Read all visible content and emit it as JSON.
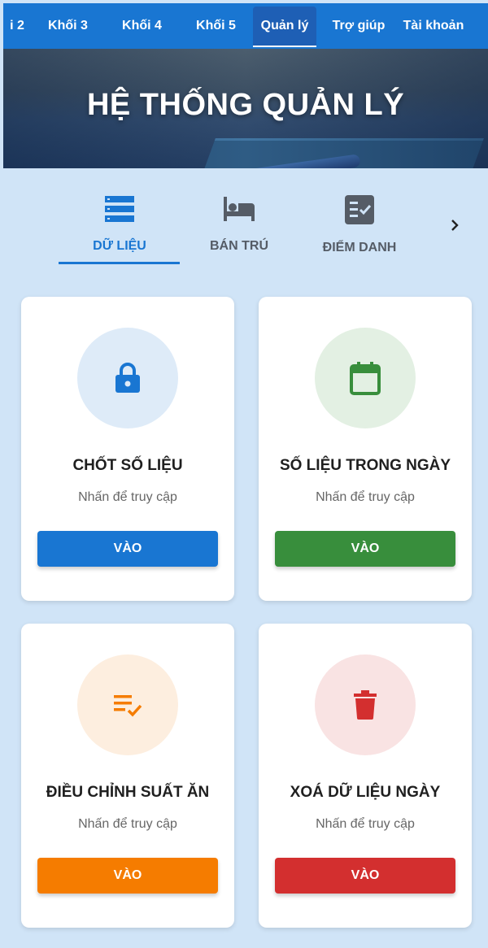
{
  "nav": {
    "items": [
      {
        "label": "i 2"
      },
      {
        "label": "Khối 3"
      },
      {
        "label": "Khối 4"
      },
      {
        "label": "Khối 5"
      },
      {
        "label": "Quản lý",
        "active": true
      },
      {
        "label": "Trợ giúp"
      },
      {
        "label": "Tài khoản"
      }
    ]
  },
  "hero": {
    "title": "HỆ THỐNG QUẢN LÝ"
  },
  "tabs": [
    {
      "label": "DỮ LIỆU",
      "icon": "list-icon",
      "active": true
    },
    {
      "label": "BÁN TRÚ",
      "icon": "bed-icon"
    },
    {
      "label": "ĐIỂM DANH",
      "icon": "checklist-icon"
    }
  ],
  "tab_next_icon": "chevron-right-icon",
  "cards": [
    {
      "title": "CHỐT SỐ LIỆU",
      "subtitle": "Nhấn để truy cập",
      "button": "VÀO",
      "icon": "lock-icon",
      "color": "#1976d2",
      "circle": "#deebf8"
    },
    {
      "title": "SỐ LIỆU TRONG NGÀY",
      "subtitle": "Nhấn để truy cập",
      "button": "VÀO",
      "icon": "calendar-icon",
      "color": "#388e3c",
      "circle": "#e3f0e3"
    },
    {
      "title": "ĐIỀU CHỈNH SUẤT ĂN",
      "subtitle": "Nhấn để truy cập",
      "button": "VÀO",
      "icon": "edit-checklist-icon",
      "color": "#f57c00",
      "circle": "#fdeedf"
    },
    {
      "title": "XOÁ DỮ LIỆU NGÀY",
      "subtitle": "Nhấn để truy cập",
      "button": "VÀO",
      "icon": "trash-icon",
      "color": "#d32f2f",
      "circle": "#f9e3e3"
    }
  ]
}
